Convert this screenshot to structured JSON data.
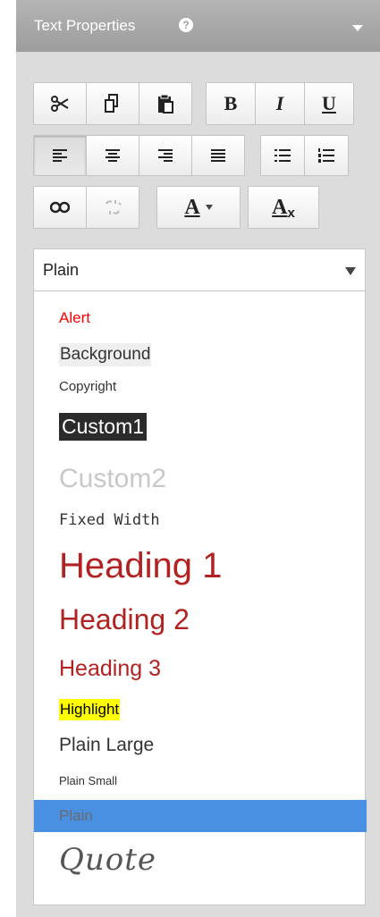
{
  "header": {
    "title": "Text Properties",
    "help_glyph": "?"
  },
  "toolbar": {
    "clipboard": [
      "cut-icon",
      "copy-icon",
      "paste-icon"
    ],
    "format": {
      "bold": "B",
      "italic": "I",
      "underline": "U"
    },
    "alignment": [
      "align-left-icon",
      "align-center-icon",
      "align-right-icon",
      "justify-icon"
    ],
    "lists": [
      "bulleted-list-icon",
      "numbered-list-icon"
    ],
    "links": [
      "link-icon",
      "unlink-icon"
    ],
    "font_color_glyph": "A",
    "clear_format_glyph": "A",
    "clear_format_sub": "x"
  },
  "style_select": {
    "value": "Plain"
  },
  "style_options": [
    {
      "label": "Alert",
      "color": "#ff0000"
    },
    {
      "label": "Background",
      "bg": "#efefef"
    },
    {
      "label": "Copyright"
    },
    {
      "label": "Custom1",
      "color": "#ffffff",
      "bg": "#2b2b2b"
    },
    {
      "label": "Custom2",
      "color": "#c8c8c8"
    },
    {
      "label": "Fixed Width"
    },
    {
      "label": "Heading 1",
      "color": "#b22222"
    },
    {
      "label": "Heading 2",
      "color": "#b22222"
    },
    {
      "label": "Heading 3",
      "color": "#b22222"
    },
    {
      "label": "Highlight",
      "bg": "#ffff00"
    },
    {
      "label": "Plain Large"
    },
    {
      "label": "Plain Small"
    },
    {
      "label": "Plain",
      "selected": true,
      "bg": "#4a90e2"
    },
    {
      "label": "Quote"
    }
  ]
}
